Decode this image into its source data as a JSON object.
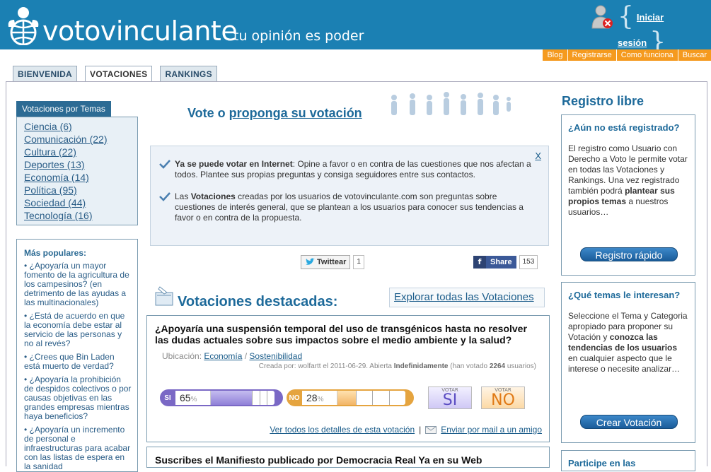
{
  "header": {
    "logo_text": "votovinculante",
    "tagline": "tu opinión es poder",
    "login_link": "Iniciar sesión",
    "brace_open": "{",
    "brace_close": "}"
  },
  "topnav": [
    "Blog",
    "Registrarse",
    "Como funciona",
    "Buscar"
  ],
  "tabs": [
    {
      "label": "BIENVENIDA",
      "active": false
    },
    {
      "label": "VOTACIONES",
      "active": true
    },
    {
      "label": "RANKINGS",
      "active": false
    }
  ],
  "sidebar": {
    "temas_title": "Votaciones por Temas",
    "temas": [
      "Ciencia (6)",
      "Comunicación (22)",
      "Cultura (22)",
      "Deportes (13)",
      "Economía (14)",
      "Política (95)",
      "Sociedad (44)",
      "Tecnología (16)"
    ],
    "populares_title": "Más populares:",
    "populares": [
      "• ¿Apoyaría un mayor fomento de la agricultura de los campesinos? (en detrimento de las ayudas a las multinacionales)",
      "• ¿Está de acuerdo en que la economía debe estar al servicio de las personas y no al revés?",
      "• ¿Crees que Bin Laden está muerto de verdad?",
      "• ¿Apoyaría la prohibición de despidos colectivos o por causas objetivas en las grandes empresas mientras haya beneficios?",
      "• ¿Apoyaría un incremento de personal e infraestructuras para acabar con las listas de espera en la sanidad"
    ]
  },
  "center": {
    "heading_prefix": "Vote o ",
    "heading_link": "proponga su votación",
    "info_close": "X",
    "info1_bold": "Ya se puede votar en Internet",
    "info1_text": ": Opine a favor o en contra de las cuestiones que nos afectan a todos. Plantee sus propias preguntas y consiga seguidores entre sus contactos.",
    "info2_pre": "Las ",
    "info2_bold": "Votaciones",
    "info2_text": " creadas por los usuarios de votovinculante.com son preguntas sobre cuestiones de interés general, que se plantean a los usuarios para conocer sus tendencias a favor o en contra de la propuesta.",
    "twitter_label": "Twittear",
    "twitter_count": "1",
    "fb_label": "Share",
    "fb_f": "f",
    "fb_count": "153",
    "destacadas_title": "Votaciones destacadas:",
    "explorar": "Explorar todas las Votaciones",
    "poll1": {
      "question": "¿Apoyaría una suspensión temporal del uso de transgénicos hasta no resolver las dudas actuales sobre sus impactos sobre el medio ambiente y la salud?",
      "loc_label": "Ubicación: ",
      "loc_cat": "Economía",
      "loc_sep": " / ",
      "loc_sub": "Sostenibilidad",
      "meta_pre": "Creada por: wolfartt el 2011-06-29. Abierta ",
      "meta_bold1": "Indefinidamente",
      "meta_mid": " (han votado ",
      "meta_bold2": "2264",
      "meta_post": " usuarios)",
      "si_label": "SI",
      "si_pct": "65",
      "no_label": "NO",
      "no_pct": "28",
      "pct_sign": "%",
      "vote_small": "VOTAR",
      "vote_si": "SI",
      "vote_no": "NO",
      "link_details": "Ver todos los detalles de esta votación",
      "link_sep": "|",
      "link_mail": "Enviar por mail a un amigo"
    },
    "poll2_question": "Suscribes el Manifiesto publicado por Democracia Real Ya en su Web"
  },
  "right": {
    "title": "Registro libre",
    "box1_title": "¿Aún no está registrado?",
    "box1_text1": "El registro como Usuario con Derecho a Voto le permite votar en todas las Votaciones y Rankings. Una vez registrado también podrá ",
    "box1_bold": "plantear sus propios temas",
    "box1_text2": " a nuestros usuarios…",
    "box1_button": "Registro rápido",
    "box2_title": "¿Qué temas le interesan?",
    "box2_text1": "Seleccione el Tema y Categoria apropiado para proponer su Votación y ",
    "box2_bold": "conozca las tendencias de los usuarios",
    "box2_text2": " en cualquier aspecto que le interese o necesite analizar…",
    "box2_button": "Crear Votación",
    "box3_title": "Participe en las"
  },
  "colors": {
    "header_bg": "#1b80b3",
    "topnav_bg": "#f59a1e",
    "accent_blue": "#1e6a9a",
    "si_purple": "#7a68c5",
    "no_orange": "#e5a43f"
  }
}
